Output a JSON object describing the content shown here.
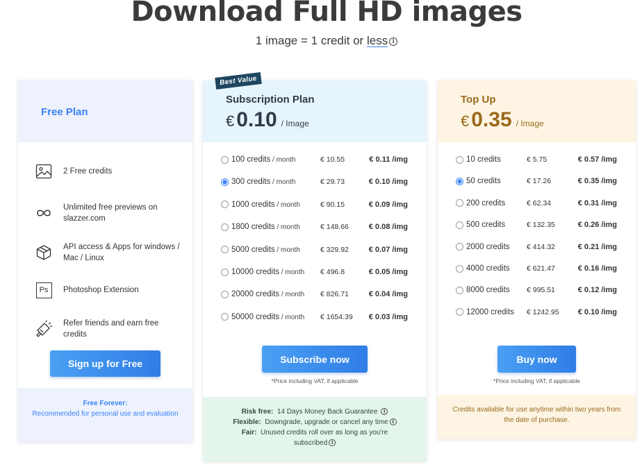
{
  "header": {
    "title": "Download Full HD images",
    "subtitle_prefix": "1 image = 1 credit or",
    "subtitle_link": "less",
    "info_glyph": "i"
  },
  "free_plan": {
    "name": "Free Plan",
    "features": [
      {
        "icon": "image-icon",
        "text": "2 Free credits"
      },
      {
        "icon": "infinity-icon",
        "text": "Unlimited free previews on slazzer.com"
      },
      {
        "icon": "cube-icon",
        "text": "API access & Apps for windows / Mac / Linux"
      },
      {
        "icon": "photoshop-icon",
        "text": "Photoshop Extension",
        "icon_text": "Ps"
      },
      {
        "icon": "megaphone-icon",
        "text": "Refer friends and earn free credits"
      }
    ],
    "button_label": "Sign up for Free",
    "footer_title": "Free Forever:",
    "footer_text": "Recommended for personal use and evaluation"
  },
  "subscription_plan": {
    "badge": "Best Value",
    "name": "Subscription Plan",
    "currency": "€",
    "price": "0.10",
    "per": "/ Image",
    "month_suffix": "/ month",
    "options": [
      {
        "credits": "100 credits",
        "total": "€ 10.55",
        "per_img": "€ 0.11 /img",
        "selected": false
      },
      {
        "credits": "300 credits",
        "total": "€ 29.73",
        "per_img": "€ 0.10 /img",
        "selected": true
      },
      {
        "credits": "1000 credits",
        "total": "€ 90.15",
        "per_img": "€ 0.09 /img",
        "selected": false
      },
      {
        "credits": "1800 credits",
        "total": "€ 148.66",
        "per_img": "€ 0.08 /img",
        "selected": false
      },
      {
        "credits": "5000 credits",
        "total": "€ 329.92",
        "per_img": "€ 0.07 /img",
        "selected": false
      },
      {
        "credits": "10000 credits",
        "total": "€ 496.8",
        "per_img": "€ 0.05 /img",
        "selected": false
      },
      {
        "credits": "20000 credits",
        "total": "€ 826.71",
        "per_img": "€ 0.04 /img",
        "selected": false
      },
      {
        "credits": "50000 credits",
        "total": "€ 1654.39",
        "per_img": "€ 0.03 /img",
        "selected": false
      }
    ],
    "button_label": "Subscribe now",
    "vat_note": "*Price including VAT, if applicable",
    "footer": [
      {
        "label": "Risk free:",
        "text": "14 Days Money Back Guarantee"
      },
      {
        "label": "Flexible:",
        "text": "Downgrade, upgrade or cancel any time"
      },
      {
        "label": "Fair:",
        "text": "Unused credits roll over as long as you're subscribed"
      }
    ]
  },
  "top_up": {
    "name": "Top Up",
    "currency": "€",
    "price": "0.35",
    "per": "/ Image",
    "options": [
      {
        "credits": "10 credits",
        "total": "€ 5.75",
        "per_img": "€ 0.57 /img",
        "selected": false
      },
      {
        "credits": "50 credits",
        "total": "€ 17.26",
        "per_img": "€ 0.35 /img",
        "selected": true
      },
      {
        "credits": "200 credits",
        "total": "€ 62.34",
        "per_img": "€ 0.31 /img",
        "selected": false
      },
      {
        "credits": "500 credits",
        "total": "€ 132.35",
        "per_img": "€ 0.26 /img",
        "selected": false
      },
      {
        "credits": "2000 credits",
        "total": "€ 414.32",
        "per_img": "€ 0.21 /img",
        "selected": false
      },
      {
        "credits": "4000 credits",
        "total": "€ 621.47",
        "per_img": "€ 0.16 /img",
        "selected": false
      },
      {
        "credits": "8000 credits",
        "total": "€ 995.51",
        "per_img": "€ 0.12 /img",
        "selected": false
      },
      {
        "credits": "12000 credits",
        "total": "€ 1242.95",
        "per_img": "€ 0.10 /img",
        "selected": false
      }
    ],
    "button_label": "Buy now",
    "vat_note": "*Price including VAT, if applicable",
    "footer_text": "Credits available for use anytime within two years from the date of purchase."
  },
  "colors": {
    "accent": "#3b82f6",
    "heading": "#3b3b3b",
    "free_bg": "#edf2fd",
    "sub_bg": "#e6f4fd",
    "topup_bg": "#fdf4e3",
    "topup_text": "#9a6a1c",
    "guarantee_bg": "#e4f5ec",
    "badge_bg": "#1e4660"
  }
}
